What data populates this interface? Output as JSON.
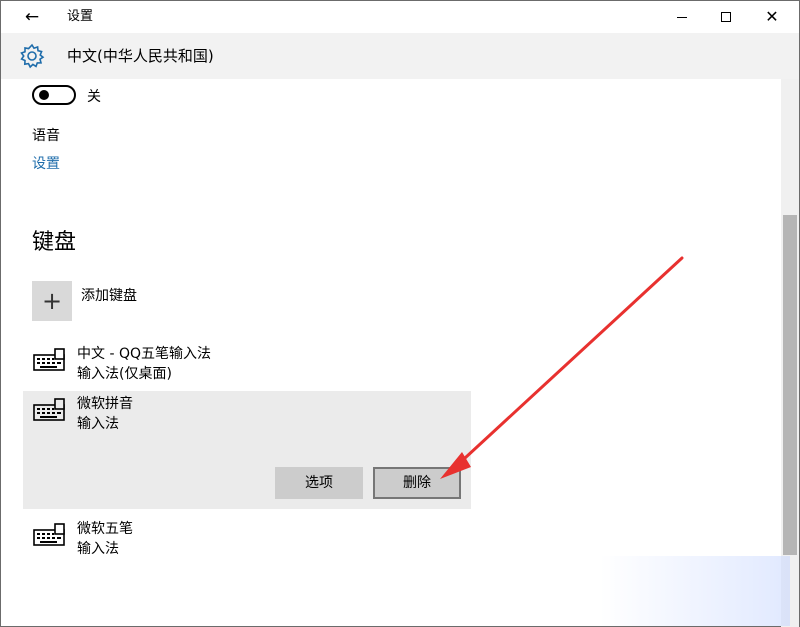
{
  "window": {
    "title": "设置",
    "back_glyph": "←",
    "close_glyph": "✕"
  },
  "header": {
    "icon": "gear-icon",
    "title": "中文(中华人民共和国)"
  },
  "toggle": {
    "state_label": "关",
    "on": false
  },
  "speech": {
    "label": "语音",
    "link": "设置"
  },
  "keyboard": {
    "heading": "键盘",
    "add_label": "添加键盘",
    "add_glyph": "+",
    "items": [
      {
        "name": "中文 - QQ五笔输入法",
        "sub": "输入法(仅桌面)",
        "icon": "keyboard-icon"
      },
      {
        "name": "微软拼音",
        "sub": "输入法",
        "icon": "keyboard-icon"
      },
      {
        "name": "微软五笔",
        "sub": "输入法",
        "icon": "keyboard-icon"
      }
    ],
    "options_label": "选项",
    "delete_label": "删除"
  },
  "colors": {
    "link": "#1f6dab",
    "header_bg": "#f2f2f2",
    "selected_bg": "#ebebeb",
    "button_bg": "#cccccc",
    "arrow": "#e8312f"
  }
}
